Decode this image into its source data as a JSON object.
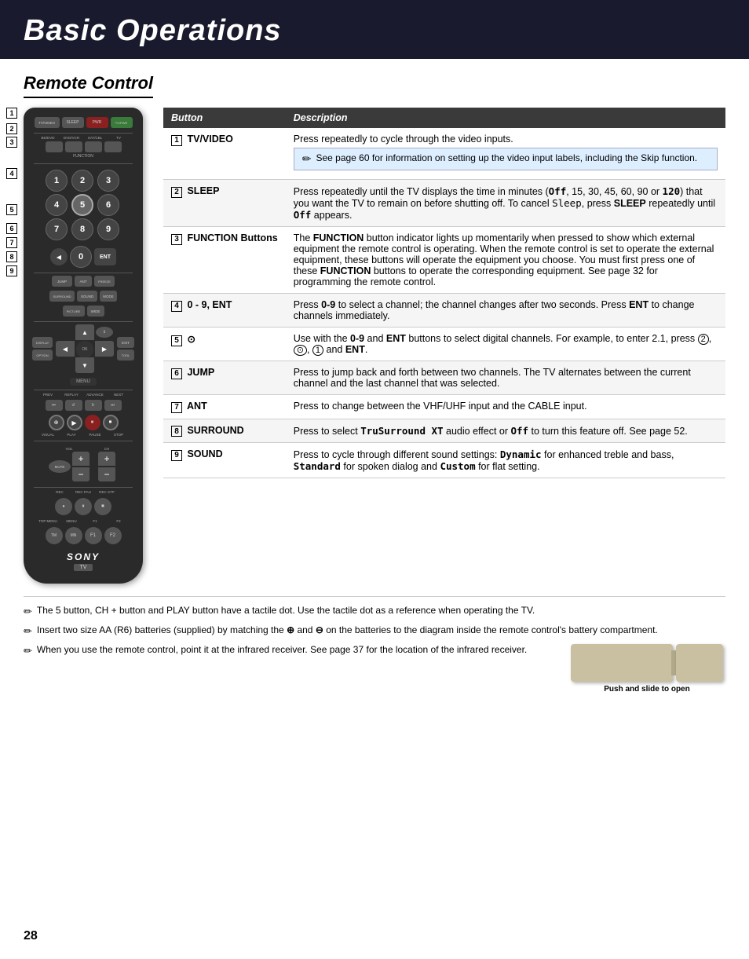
{
  "header": {
    "title": "Basic Operations"
  },
  "section": {
    "title": "Remote Control"
  },
  "table": {
    "col1": "Button",
    "col2": "Description",
    "rows": [
      {
        "num": "1",
        "button": "TV/VIDEO",
        "description": "Press repeatedly to cycle through the video inputs.",
        "note": "See page 60 for information on setting up the video input labels, including the Skip function."
      },
      {
        "num": "2",
        "button": "SLEEP",
        "description": "Press repeatedly until the TV displays the time in minutes (Off, 15, 30, 45, 60, 90 or 120) that you want the TV to remain on before shutting off. To cancel Sleep, press SLEEP repeatedly until Off appears.",
        "note": ""
      },
      {
        "num": "3",
        "button": "FUNCTION Buttons",
        "description": "The FUNCTION button indicator lights up momentarily when pressed to show which external equipment the remote control is operating. When the remote control is set to operate the external equipment, these buttons will operate the equipment you choose. You must first press one of these FUNCTION buttons to operate the corresponding equipment. See page 32 for programming the remote control.",
        "note": ""
      },
      {
        "num": "4",
        "button": "0 - 9, ENT",
        "description": "Press 0-9 to select a channel; the channel changes after two seconds. Press ENT to change channels immediately.",
        "note": ""
      },
      {
        "num": "5",
        "button": "⊙",
        "description": "Use with the 0-9 and ENT buttons to select digital channels. For example, to enter 2.1, press ②, ⊙, ① and ENT.",
        "note": ""
      },
      {
        "num": "6",
        "button": "JUMP",
        "description": "Press to jump back and forth between two channels. The TV alternates between the current channel and the last channel that was selected.",
        "note": ""
      },
      {
        "num": "7",
        "button": "ANT",
        "description": "Press to change between the VHF/UHF input and the CABLE input.",
        "note": ""
      },
      {
        "num": "8",
        "button": "SURROUND",
        "description": "Press to select TruSurround XT audio effect or Off to turn this feature off. See page 52.",
        "note": ""
      },
      {
        "num": "9",
        "button": "SOUND",
        "description": "Press to cycle through different sound settings: Dynamic for enhanced treble and bass, Standard for spoken dialog and Custom for flat setting.",
        "note": ""
      }
    ]
  },
  "footer_notes": [
    "The 5 button, CH + button and PLAY button have a tactile dot. Use the tactile dot as a reference when operating the TV.",
    "Insert two size AA (R6) batteries (supplied) by matching the ➕ and ➖ on the batteries to the diagram inside the remote control's battery compartment.",
    "When you use the remote control, point it at the infrared receiver. See page 37 for the location of the infrared receiver."
  ],
  "battery_caption": "Push and slide to open",
  "page_number": "28",
  "remote": {
    "top_buttons": [
      "TV/VIDEO",
      "SLEEP",
      "POWER",
      "TV/PWR"
    ],
    "function_labels": [
      "BD/DVD",
      "DVD/VCR",
      "SAT/CABLE",
      "TV"
    ],
    "numpad": [
      "1",
      "2",
      "3",
      "4",
      "5",
      "6",
      "7",
      "8",
      "9"
    ],
    "row_labels": [
      "1",
      "2",
      "3",
      "4",
      "5",
      "6",
      "7",
      "8",
      "9"
    ],
    "func_btns": [
      "JUMP",
      "ANT",
      "⬛",
      "FREEZE",
      "SURROUND",
      "SOUND",
      "MODE",
      "⬛",
      "⬛",
      "PICTURE",
      "⬛",
      "WIDE"
    ],
    "transport_labels": [
      "PREV",
      "REPLAY",
      "ADVANCE",
      "NEXT"
    ],
    "play_labels": [
      "⬛",
      "▶",
      "⬛"
    ],
    "vol_label": "VOL",
    "ch_label": "CH",
    "muting": "MUTING",
    "bottom_labels": [
      "REC",
      "REC PAUSE",
      "REC STOP"
    ],
    "bottom_func": [
      "TOP MENU",
      "MENU",
      "F1",
      "F2"
    ],
    "sony_logo": "SONY",
    "tv_badge": "TV"
  }
}
